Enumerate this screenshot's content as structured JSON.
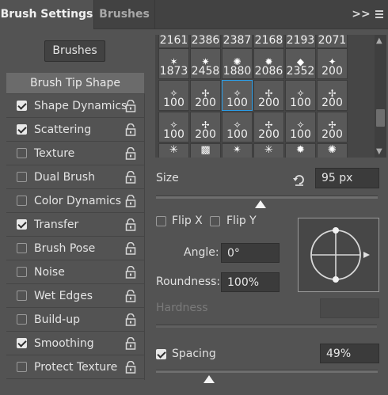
{
  "tabs": {
    "active": "Brush Settings",
    "other": "Brushes",
    "expand": ">>"
  },
  "brushes_button": "Brushes",
  "tip_shape": "Brush Tip Shape",
  "options": [
    {
      "label": "Shape Dynamics",
      "checked": true
    },
    {
      "label": "Scattering",
      "checked": true
    },
    {
      "label": "Texture",
      "checked": false
    },
    {
      "label": "Dual Brush",
      "checked": false
    },
    {
      "label": "Color Dynamics",
      "checked": false
    },
    {
      "label": "Transfer",
      "checked": true
    },
    {
      "label": "Brush Pose",
      "checked": false
    },
    {
      "label": "Noise",
      "checked": false
    },
    {
      "label": "Wet Edges",
      "checked": false
    },
    {
      "label": "Build-up",
      "checked": false
    },
    {
      "label": "Smoothing",
      "checked": true
    },
    {
      "label": "Protect Texture",
      "checked": false
    }
  ],
  "grid": {
    "rows": [
      [
        "2161",
        "2386",
        "2387",
        "2168",
        "2193",
        "2071"
      ],
      [
        "1873",
        "2458",
        "1880",
        "2086",
        "2352",
        "200"
      ],
      [
        "100",
        "200",
        "100",
        "200",
        "100",
        "200"
      ],
      [
        "100",
        "200",
        "100",
        "200",
        "100",
        "200"
      ],
      [
        "",
        "",
        "",
        "",
        "",
        ""
      ]
    ],
    "selected": [
      2,
      2
    ]
  },
  "size": {
    "label": "Size",
    "value": "95 px",
    "slider": 0.47
  },
  "flip_x": {
    "label": "Flip X",
    "checked": false
  },
  "flip_y": {
    "label": "Flip Y",
    "checked": false
  },
  "angle": {
    "label": "Angle:",
    "value": "0°"
  },
  "roundness": {
    "label": "Roundness:",
    "value": "100%"
  },
  "hardness": {
    "label": "Hardness",
    "value": ""
  },
  "spacing": {
    "label": "Spacing",
    "checked": true,
    "value": "49%",
    "slider": 0.24
  }
}
